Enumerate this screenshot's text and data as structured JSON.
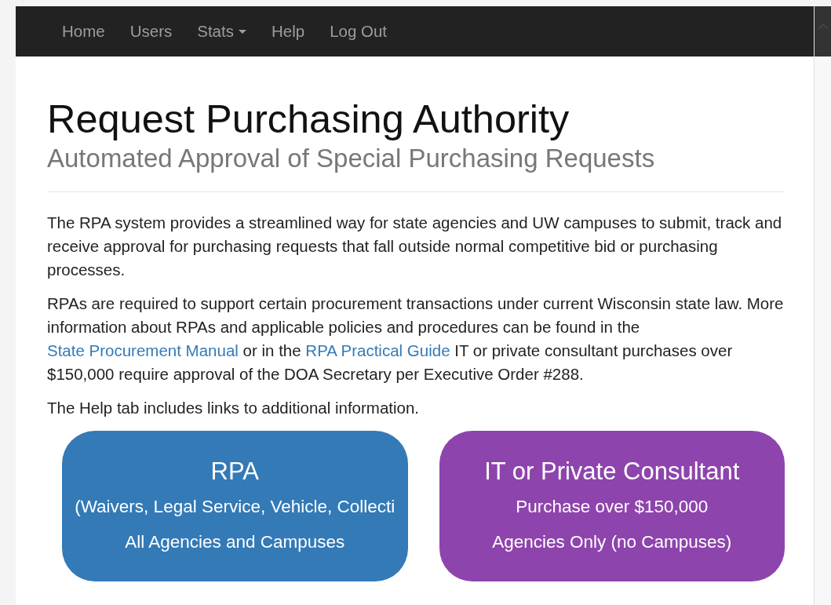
{
  "navbar": {
    "items": [
      {
        "label": "Home",
        "kind": "link"
      },
      {
        "label": "Users",
        "kind": "link"
      },
      {
        "label": "Stats",
        "kind": "dropdown"
      },
      {
        "label": "Help",
        "kind": "link"
      },
      {
        "label": "Log Out",
        "kind": "link"
      }
    ]
  },
  "header": {
    "title": "Request Purchasing Authority",
    "subtitle": "Automated Approval of Special Purchasing Requests"
  },
  "paragraphs": [
    {
      "parts": [
        {
          "kind": "text",
          "text": "The RPA system provides a streamlined way for state agencies and UW campuses to submit, track and receive approval for purchasing requests that fall outside normal competitive bid or purchasing processes."
        }
      ]
    },
    {
      "parts": [
        {
          "kind": "text",
          "text": "RPAs are required to support certain procurement transactions under current Wisconsin state law. More information about RPAs and applicable policies and procedures can be found in the "
        },
        {
          "kind": "link",
          "text": "State Procurement Manual"
        },
        {
          "kind": "text",
          "text": " or in the "
        },
        {
          "kind": "link",
          "text": "RPA Practical Guide"
        },
        {
          "kind": "text",
          "text": " IT or private consultant purchases over $150,000 require approval of the DOA Secretary per Executive Order #288."
        }
      ]
    },
    {
      "parts": [
        {
          "kind": "text",
          "text": "The Help tab includes links to additional information."
        }
      ]
    }
  ],
  "cards": [
    {
      "title": "RPA",
      "line_1": "(Waivers, Legal Service, Vehicle, Collecti",
      "line_2": "All Agencies and Campuses",
      "color": "#337ab7"
    },
    {
      "title": "IT or Private Consultant",
      "line_1": "Purchase over $150,000",
      "line_2": "Agencies Only (no Campuses)",
      "color": "#8e44ad"
    }
  ]
}
